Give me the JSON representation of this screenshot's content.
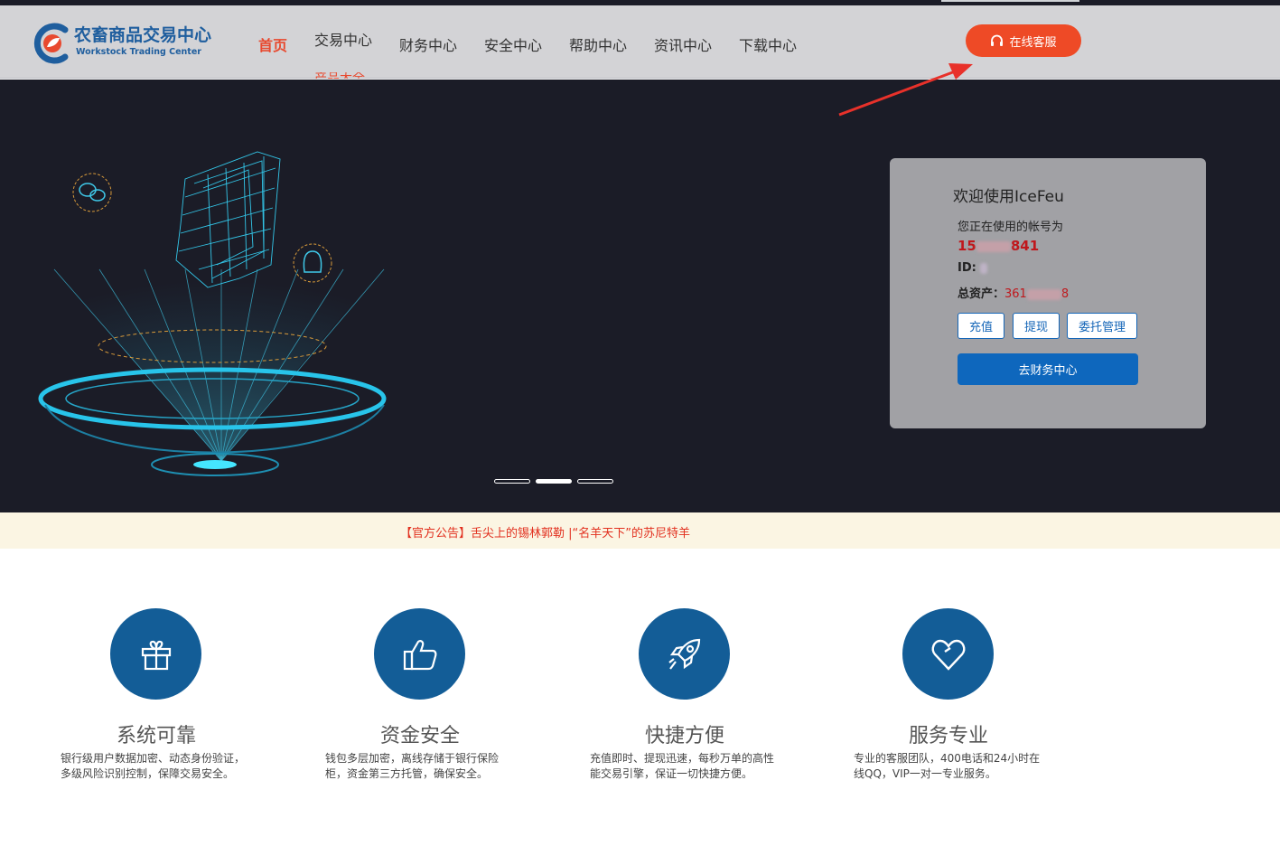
{
  "logo": {
    "name_cn": "农畜商品交易中心",
    "name_en": "Workstock Trading Center"
  },
  "nav": {
    "items": [
      {
        "label": "首页",
        "active": true
      },
      {
        "label": "交易中心"
      },
      {
        "label": "财务中心"
      },
      {
        "label": "安全中心"
      },
      {
        "label": "帮助中心"
      },
      {
        "label": "资讯中心"
      },
      {
        "label": "下载中心"
      }
    ],
    "submenu_peek": "产品大全",
    "online_service_label": "在线客服"
  },
  "colors": {
    "accent": "#e8492f",
    "primary_blue": "#135d97",
    "button_blue": "#0e67bd",
    "banner_bg": "#1b1c27",
    "annotation_arrow": "#e8312a"
  },
  "banner": {
    "slide_count": 3,
    "active_slide": 2
  },
  "account": {
    "welcome": "欢迎使用IceFeu",
    "account_label": "您正在使用的帐号为",
    "account_prefix": "15",
    "account_suffix": "841",
    "id_label": "ID:",
    "total_label": "总资产：",
    "total_prefix": "361",
    "total_suffix": "8",
    "buttons": {
      "recharge": "充值",
      "withdraw": "提现",
      "entrust": "委托管理"
    },
    "finance_center_label": "去财务中心"
  },
  "notice": {
    "text": "【官方公告】舌尖上的锡林郭勒 |“名羊天下”的苏尼特羊"
  },
  "features": [
    {
      "icon": "gift-icon",
      "title": "系统可靠",
      "desc": "银行级用户数据加密、动态身份验证，多级风险识别控制，保障交易安全。"
    },
    {
      "icon": "thumbs-up-icon",
      "title": "资金安全",
      "desc": "钱包多层加密，离线存储于银行保险柜，资金第三方托管，确保安全。"
    },
    {
      "icon": "rocket-icon",
      "title": "快捷方便",
      "desc": "充值即时、提现迅速，每秒万单的高性能交易引擎，保证一切快捷方便。"
    },
    {
      "icon": "heart-icon",
      "title": "服务专业",
      "desc": "专业的客服团队，400电话和24小时在线QQ，VIP一对一专业服务。"
    }
  ]
}
